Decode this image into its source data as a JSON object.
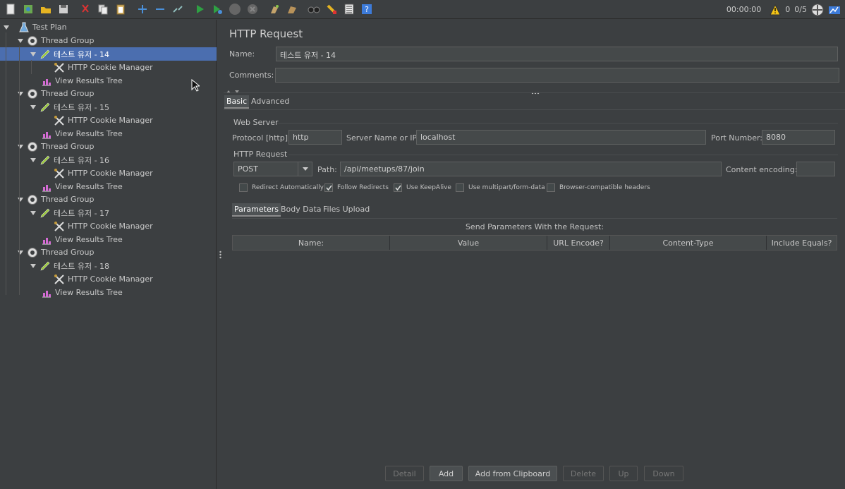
{
  "toolbar": {
    "timer": "00:00:00",
    "warning_count": "0",
    "threads": "0/5",
    "icons": [
      "new-icon",
      "templates-icon",
      "open-icon",
      "save-icon",
      "cut-icon",
      "copy-icon",
      "paste-icon",
      "expand-icon",
      "collapse-icon",
      "toggle-icon",
      "start-icon",
      "start-no-pause-icon",
      "stop-icon",
      "shutdown-icon",
      "clear-icon",
      "clear-all-icon",
      "search-icon",
      "reset-search-icon",
      "function-helper-icon",
      "help-icon"
    ]
  },
  "tree": {
    "root": "Test Plan",
    "groups": [
      {
        "name": "Thread Group",
        "controller": "테스트 유저 - 14",
        "cookie": "HTTP Cookie Manager",
        "results": "View Results Tree"
      },
      {
        "name": "Thread Group",
        "controller": "테스트 유저 - 15",
        "cookie": "HTTP Cookie Manager",
        "results": "View Results Tree"
      },
      {
        "name": "Thread Group",
        "controller": "테스트 유저 - 16",
        "cookie": "HTTP Cookie Manager",
        "results": "View Results Tree"
      },
      {
        "name": "Thread Group",
        "controller": "테스트 유저 - 17",
        "cookie": "HTTP Cookie Manager",
        "results": "View Results Tree"
      },
      {
        "name": "Thread Group",
        "controller": "테스트 유저 - 18",
        "cookie": "HTTP Cookie Manager",
        "results": "View Results Tree"
      }
    ]
  },
  "panel": {
    "title": "HTTP Request",
    "name_label": "Name:",
    "name_value": "테스트 유저 - 14",
    "comments_label": "Comments:",
    "comments_value": "",
    "tabs": [
      "Basic",
      "Advanced"
    ],
    "web_server_label": "Web Server",
    "protocol_label": "Protocol [http]:",
    "protocol_value": "http",
    "server_label": "Server Name or IP:",
    "server_value": "localhost",
    "port_label": "Port Number:",
    "port_value": "8080",
    "http_request_label": "HTTP Request",
    "method": "POST",
    "path_label": "Path:",
    "path_value": "/api/meetups/87/join",
    "encoding_label": "Content encoding:",
    "encoding_value": "",
    "checkboxes": [
      {
        "label": "Redirect Automatically",
        "checked": false
      },
      {
        "label": "Follow Redirects",
        "checked": true
      },
      {
        "label": "Use KeepAlive",
        "checked": true
      },
      {
        "label": "Use multipart/form-data",
        "checked": false
      },
      {
        "label": "Browser-compatible headers",
        "checked": false
      }
    ],
    "sub_tabs": [
      "Parameters",
      "Body Data",
      "Files Upload"
    ],
    "params_caption": "Send Parameters With the Request:",
    "columns": [
      "Name:",
      "Value",
      "URL Encode?",
      "Content-Type",
      "Include Equals?"
    ],
    "buttons": [
      {
        "label": "Detail",
        "enabled": false
      },
      {
        "label": "Add",
        "enabled": true
      },
      {
        "label": "Add from Clipboard",
        "enabled": true
      },
      {
        "label": "Delete",
        "enabled": false
      },
      {
        "label": "Up",
        "enabled": false
      },
      {
        "label": "Down",
        "enabled": false
      }
    ]
  }
}
